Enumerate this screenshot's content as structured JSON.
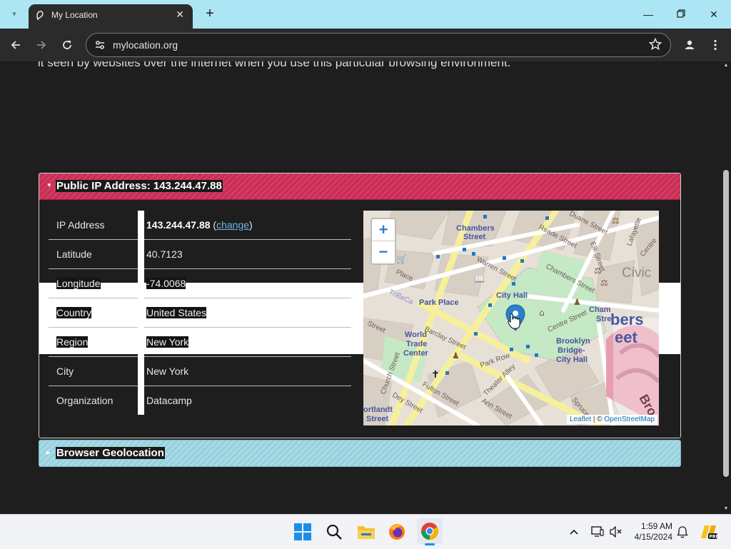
{
  "browser": {
    "tab_title": "My Location",
    "url": "mylocation.org",
    "new_tab_label": "+",
    "close_tab_label": "✕"
  },
  "page": {
    "intro_text": "it seen by websites over the internet when you use this particular browsing environment.",
    "public_ip_header": "Public IP Address: 143.244.47.88",
    "geolocation_header": "Browser Geolocation",
    "rows": [
      {
        "key": "IP Address",
        "value": "143.244.47.88",
        "link": "change"
      },
      {
        "key": "Latitude",
        "value": "40.7123"
      },
      {
        "key": "Longitude",
        "value": "-74.0068"
      },
      {
        "key": "Country",
        "value": "United States"
      },
      {
        "key": "Region",
        "value": "New York"
      },
      {
        "key": "City",
        "value": "New York"
      },
      {
        "key": "Organization",
        "value": "Datacamp"
      }
    ],
    "ip_link_open": "(",
    "ip_link_close": ")"
  },
  "map": {
    "zoom_in": "+",
    "zoom_out": "−",
    "attribution_leaflet": "Leaflet",
    "attribution_sep": " | © ",
    "attribution_osm": "OpenStreetMap",
    "labels": {
      "chambers_street_1": "Chambers",
      "chambers_street_2": "Street",
      "warren_street": "Warren Street",
      "reade_street": "Reade Street",
      "duane_street": "Duane Street",
      "chambers_street_road": "Chambers Street",
      "elk_street": "Elk Street",
      "lafayette": "Lafayette",
      "centre": "Centre",
      "civic": "Civic",
      "place": "Place",
      "tribeca": "TriBeCa",
      "city_hall": "City Hall",
      "park_place": "Park Place",
      "cham_stre_1": "Cham",
      "cham_stre_2": "Stre",
      "bers_1": "bers",
      "bers_2": "eet",
      "street_left": "Street",
      "barclay_street": "Barclay Street",
      "centre_street": "Centre Street",
      "wtc_1": "World",
      "wtc_2": "Trade",
      "wtc_3": "Center",
      "brooklyn_1": "Brooklyn",
      "brooklyn_2": "Bridge-",
      "brooklyn_3": "City Hall",
      "park_row": "Park Row",
      "church_street": "Church Street",
      "fulton_street": "Fulton Street",
      "theater_alley": "Theater Alley",
      "dey_street": "Dey Street",
      "ann_street": "Ann Street",
      "spruce": "Spruce",
      "bro": "Bro",
      "cortlandt_1": "ortlandt",
      "cortlandt_2": "Street"
    }
  },
  "taskbar": {
    "time": "1:59 AM",
    "date": "4/15/2024"
  },
  "colors": {
    "accent_red": "#c82c55",
    "accent_teal": "#a8dbe6",
    "tab_strip": "#ace6f4",
    "link": "#6cb8e4",
    "map_pin": "#2a81cb"
  }
}
